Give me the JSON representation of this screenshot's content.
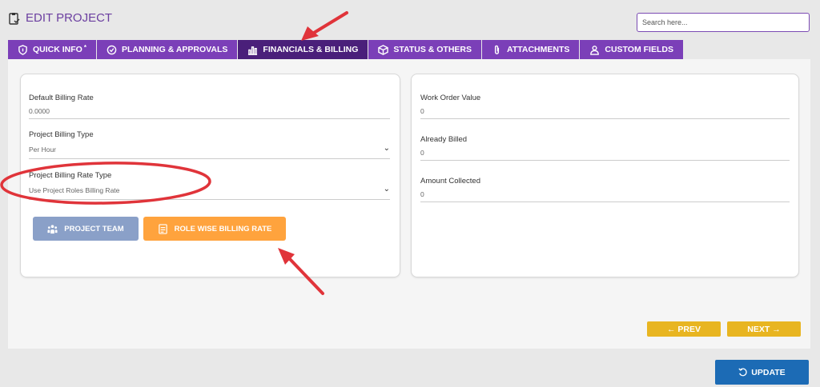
{
  "header": {
    "title": "EDIT PROJECT",
    "icon": "clipboard-check-icon"
  },
  "search": {
    "placeholder": "Search here..."
  },
  "tabs": [
    {
      "label": "QUICK INFO",
      "marker": "*",
      "icon": "info-shield-icon",
      "active": false
    },
    {
      "label": "PLANNING & APPROVALS",
      "icon": "check-circle-icon",
      "active": false
    },
    {
      "label": "FINANCIALS & BILLING",
      "icon": "bar-chart-icon",
      "active": true
    },
    {
      "label": "STATUS & OTHERS",
      "icon": "box-icon",
      "active": false
    },
    {
      "label": "ATTACHMENTS",
      "icon": "paperclip-icon",
      "active": false
    },
    {
      "label": "CUSTOM FIELDS",
      "icon": "user-outline-icon",
      "active": false
    }
  ],
  "left_card": {
    "default_billing_rate": {
      "label": "Default Billing Rate",
      "value": "0.0000"
    },
    "project_billing_type": {
      "label": "Project Billing Type",
      "value": "Per Hour"
    },
    "project_billing_rate_type": {
      "label": "Project Billing Rate Type",
      "value": "Use Project Roles Billing Rate"
    },
    "buttons": {
      "project_team": "PROJECT TEAM",
      "role_wise": "ROLE WISE BILLING RATE"
    }
  },
  "right_card": {
    "work_order_value": {
      "label": "Work Order Value",
      "value": "0"
    },
    "already_billed": {
      "label": "Already Billed",
      "value": "0"
    },
    "amount_collected": {
      "label": "Amount Collected",
      "value": "0"
    }
  },
  "nav": {
    "prev": "← PREV",
    "next": "NEXT →"
  },
  "update": {
    "label": "UPDATE"
  },
  "colors": {
    "tab_bg": "#7b3fb8",
    "tab_active": "#4a1f7a",
    "role_button": "#ffa33d",
    "team_button": "#8aa0c8",
    "nav_button": "#e8b521",
    "update_button": "#1c6bb5",
    "annotation": "#e0343a"
  }
}
